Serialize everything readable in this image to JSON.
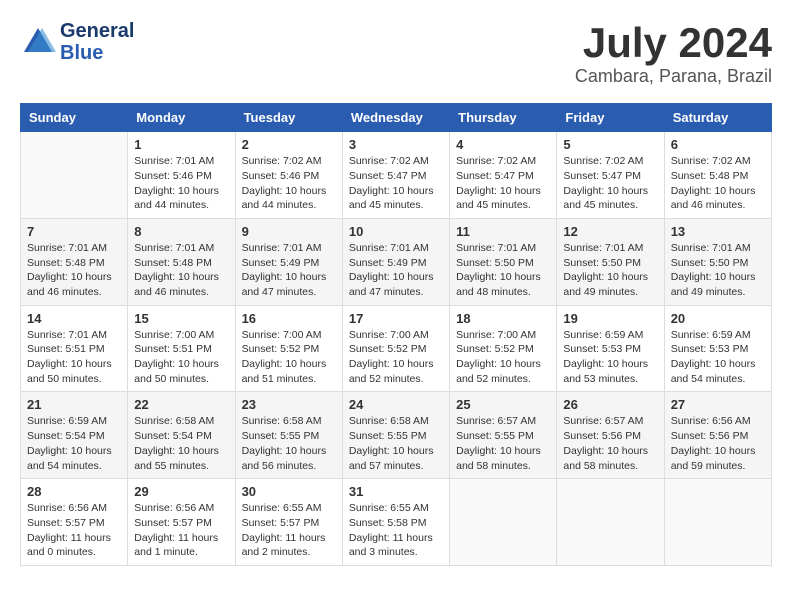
{
  "header": {
    "logo_line1": "General",
    "logo_line2": "Blue",
    "month": "July 2024",
    "location": "Cambara, Parana, Brazil"
  },
  "weekdays": [
    "Sunday",
    "Monday",
    "Tuesday",
    "Wednesday",
    "Thursday",
    "Friday",
    "Saturday"
  ],
  "weeks": [
    [
      {
        "day": "",
        "info": ""
      },
      {
        "day": "1",
        "info": "Sunrise: 7:01 AM\nSunset: 5:46 PM\nDaylight: 10 hours\nand 44 minutes."
      },
      {
        "day": "2",
        "info": "Sunrise: 7:02 AM\nSunset: 5:46 PM\nDaylight: 10 hours\nand 44 minutes."
      },
      {
        "day": "3",
        "info": "Sunrise: 7:02 AM\nSunset: 5:47 PM\nDaylight: 10 hours\nand 45 minutes."
      },
      {
        "day": "4",
        "info": "Sunrise: 7:02 AM\nSunset: 5:47 PM\nDaylight: 10 hours\nand 45 minutes."
      },
      {
        "day": "5",
        "info": "Sunrise: 7:02 AM\nSunset: 5:47 PM\nDaylight: 10 hours\nand 45 minutes."
      },
      {
        "day": "6",
        "info": "Sunrise: 7:02 AM\nSunset: 5:48 PM\nDaylight: 10 hours\nand 46 minutes."
      }
    ],
    [
      {
        "day": "7",
        "info": "Sunrise: 7:01 AM\nSunset: 5:48 PM\nDaylight: 10 hours\nand 46 minutes."
      },
      {
        "day": "8",
        "info": "Sunrise: 7:01 AM\nSunset: 5:48 PM\nDaylight: 10 hours\nand 46 minutes."
      },
      {
        "day": "9",
        "info": "Sunrise: 7:01 AM\nSunset: 5:49 PM\nDaylight: 10 hours\nand 47 minutes."
      },
      {
        "day": "10",
        "info": "Sunrise: 7:01 AM\nSunset: 5:49 PM\nDaylight: 10 hours\nand 47 minutes."
      },
      {
        "day": "11",
        "info": "Sunrise: 7:01 AM\nSunset: 5:50 PM\nDaylight: 10 hours\nand 48 minutes."
      },
      {
        "day": "12",
        "info": "Sunrise: 7:01 AM\nSunset: 5:50 PM\nDaylight: 10 hours\nand 49 minutes."
      },
      {
        "day": "13",
        "info": "Sunrise: 7:01 AM\nSunset: 5:50 PM\nDaylight: 10 hours\nand 49 minutes."
      }
    ],
    [
      {
        "day": "14",
        "info": "Sunrise: 7:01 AM\nSunset: 5:51 PM\nDaylight: 10 hours\nand 50 minutes."
      },
      {
        "day": "15",
        "info": "Sunrise: 7:00 AM\nSunset: 5:51 PM\nDaylight: 10 hours\nand 50 minutes."
      },
      {
        "day": "16",
        "info": "Sunrise: 7:00 AM\nSunset: 5:52 PM\nDaylight: 10 hours\nand 51 minutes."
      },
      {
        "day": "17",
        "info": "Sunrise: 7:00 AM\nSunset: 5:52 PM\nDaylight: 10 hours\nand 52 minutes."
      },
      {
        "day": "18",
        "info": "Sunrise: 7:00 AM\nSunset: 5:52 PM\nDaylight: 10 hours\nand 52 minutes."
      },
      {
        "day": "19",
        "info": "Sunrise: 6:59 AM\nSunset: 5:53 PM\nDaylight: 10 hours\nand 53 minutes."
      },
      {
        "day": "20",
        "info": "Sunrise: 6:59 AM\nSunset: 5:53 PM\nDaylight: 10 hours\nand 54 minutes."
      }
    ],
    [
      {
        "day": "21",
        "info": "Sunrise: 6:59 AM\nSunset: 5:54 PM\nDaylight: 10 hours\nand 54 minutes."
      },
      {
        "day": "22",
        "info": "Sunrise: 6:58 AM\nSunset: 5:54 PM\nDaylight: 10 hours\nand 55 minutes."
      },
      {
        "day": "23",
        "info": "Sunrise: 6:58 AM\nSunset: 5:55 PM\nDaylight: 10 hours\nand 56 minutes."
      },
      {
        "day": "24",
        "info": "Sunrise: 6:58 AM\nSunset: 5:55 PM\nDaylight: 10 hours\nand 57 minutes."
      },
      {
        "day": "25",
        "info": "Sunrise: 6:57 AM\nSunset: 5:55 PM\nDaylight: 10 hours\nand 58 minutes."
      },
      {
        "day": "26",
        "info": "Sunrise: 6:57 AM\nSunset: 5:56 PM\nDaylight: 10 hours\nand 58 minutes."
      },
      {
        "day": "27",
        "info": "Sunrise: 6:56 AM\nSunset: 5:56 PM\nDaylight: 10 hours\nand 59 minutes."
      }
    ],
    [
      {
        "day": "28",
        "info": "Sunrise: 6:56 AM\nSunset: 5:57 PM\nDaylight: 11 hours\nand 0 minutes."
      },
      {
        "day": "29",
        "info": "Sunrise: 6:56 AM\nSunset: 5:57 PM\nDaylight: 11 hours\nand 1 minute."
      },
      {
        "day": "30",
        "info": "Sunrise: 6:55 AM\nSunset: 5:57 PM\nDaylight: 11 hours\nand 2 minutes."
      },
      {
        "day": "31",
        "info": "Sunrise: 6:55 AM\nSunset: 5:58 PM\nDaylight: 11 hours\nand 3 minutes."
      },
      {
        "day": "",
        "info": ""
      },
      {
        "day": "",
        "info": ""
      },
      {
        "day": "",
        "info": ""
      }
    ]
  ]
}
